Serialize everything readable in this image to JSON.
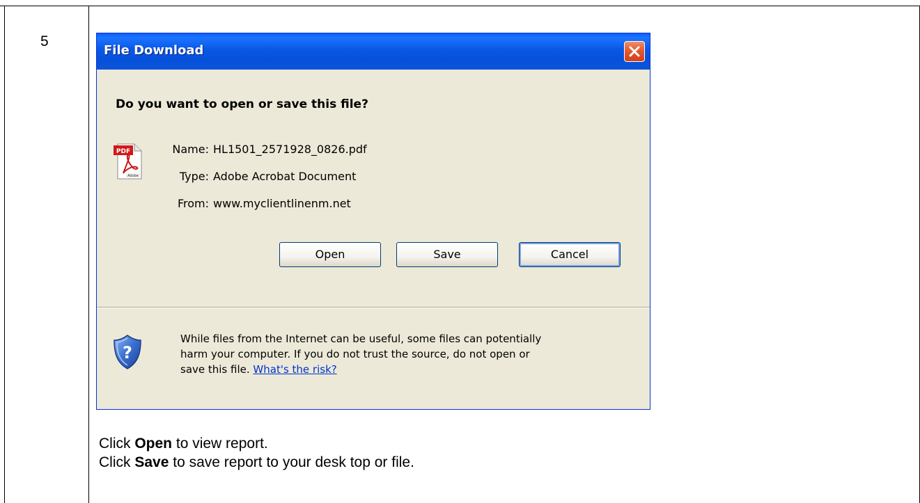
{
  "step": {
    "number": "5"
  },
  "dialog": {
    "title": "File Download",
    "question": "Do you want to open or save this file?",
    "file": {
      "icon": "pdf-file-icon",
      "name_label": "Name:",
      "name_value": "HL1501_2571928_0826.pdf",
      "type_label": "Type:",
      "type_value": "Adobe Acrobat Document",
      "from_label": "From:",
      "from_value": "www.myclientlinenm.net"
    },
    "buttons": {
      "open": "Open",
      "save": "Save",
      "cancel": "Cancel"
    },
    "warning": {
      "icon": "shield-question-icon",
      "line1": "While files from the Internet can be useful, some files can potentially",
      "line2": "harm your computer. If you do not trust the source, do not open or",
      "line3_prefix": "save this file.",
      "risk_link": "What's the risk?"
    },
    "colors": {
      "title_bar": "#0a57e6",
      "body": "#ece9d8",
      "close": "#e5592f"
    }
  },
  "instructions": {
    "line1_prefix": "Click",
    "line1_bold": "Open",
    "line1_suffix": "to view report.",
    "line2_prefix": "Click",
    "line2_bold": "Save",
    "line2_suffix": "to save report to your desk top or file."
  }
}
